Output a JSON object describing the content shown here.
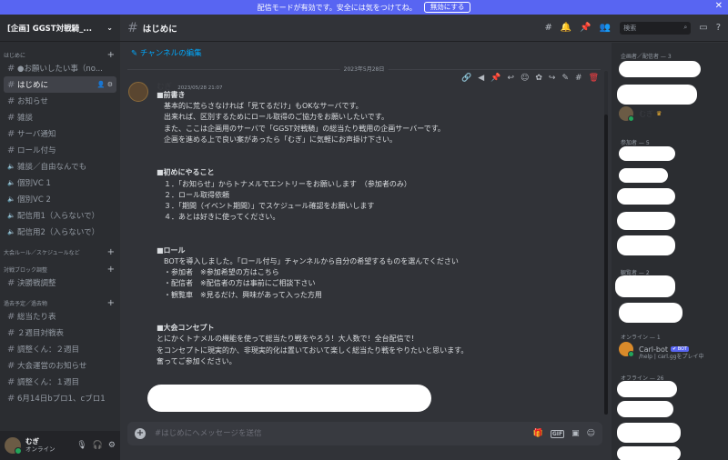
{
  "banner": {
    "text": "配信モードが有効です。安全には気をつけてね。",
    "button_label": "無効にする",
    "close_glyph": "✕"
  },
  "server": {
    "name": "[企画] GGST対戦騎_..."
  },
  "sidebar": {
    "categories": [
      {
        "label": "はじめに",
        "channels": [
          {
            "label": "●お願いしたい事（no...",
            "type": "text",
            "active": false
          },
          {
            "label": "はじめに",
            "type": "text",
            "active": true
          },
          {
            "label": "お知らせ",
            "type": "text",
            "active": false
          },
          {
            "label": "雑談",
            "type": "text",
            "active": false
          },
          {
            "label": "サーバ通知",
            "type": "text",
            "active": false
          },
          {
            "label": "ロール付与",
            "type": "text",
            "active": false
          },
          {
            "label": "雑談／自由なんでも",
            "type": "voice",
            "active": false
          },
          {
            "label": "個別VC 1",
            "type": "voice",
            "active": false
          },
          {
            "label": "個別VC 2",
            "type": "voice",
            "active": false
          },
          {
            "label": "配信用1（入らないで）",
            "type": "voice",
            "active": false
          },
          {
            "label": "配信用2（入らないで）",
            "type": "voice",
            "active": false
          }
        ]
      },
      {
        "label": "大会ルール／スケジュールなど",
        "channels": []
      },
      {
        "label": "対戦ブロック調整",
        "channels": [
          {
            "label": "決勝戦調整",
            "type": "text",
            "active": false
          }
        ]
      },
      {
        "label": "過去予定／過去物",
        "channels": [
          {
            "label": "総当たり表",
            "type": "text",
            "active": false
          },
          {
            "label": "２週目対戦表",
            "type": "text",
            "active": false
          },
          {
            "label": "調整くん：２週目",
            "type": "text",
            "active": false
          },
          {
            "label": "大会運営のお知らせ",
            "type": "text",
            "active": false
          },
          {
            "label": "調整くん：１週目",
            "type": "text",
            "active": false
          },
          {
            "label": "6月14日bブロ1、cブロ1",
            "type": "text",
            "active": false
          }
        ]
      }
    ]
  },
  "user": {
    "name": "むぎ",
    "status": "オンライン"
  },
  "channel": {
    "title": "はじめに",
    "edit_link": "✎ チャンネルの編集"
  },
  "search": {
    "placeholder": "検索"
  },
  "message": {
    "date": "2023年5月28日",
    "author": "むぎ",
    "timestamp": "2023/05/28 21:07",
    "lines": [
      "■前書き",
      "　基本的に荒らさなければ「見てるだけ」もOKなサーバです。",
      "　出来れば、区別するためにロール取得のご協力をお願いしたいです。",
      "　また、ここは企画用のサーバで「GGST対戦騎」の総当たり戦用の企画サーバーです。",
      "　企画を進める上で良い案があったら「むぎ」に気軽にお声掛け下さい。",
      "",
      "",
      "■初めにやること",
      "　１．「お知らせ」からトナメルでエントリーをお願いします　（参加者のみ）",
      "　２．ロール取得依頼",
      "　３．「期間（イベント期間）」でスケジュール確認をお願いします",
      "　４．あとは好きに使ってください。",
      "",
      "",
      "■ロール",
      "　BOTを導入しました。「ロール付与」チャンネルから自分の希望するものを選んでください",
      "　・参加者　※参加希望の方はこちら",
      "　・配信者　※配信者の方は事前にご相談下さい",
      "　・観覧車　※見るだけ、興味があって入った方用",
      "",
      "",
      "■大会コンセプト",
      "とにかくトナメルの機能を使って総当たり戦をやろう！大人数で！全台配信で！",
      "をコンセプトに現実的か、非現実的化は置いておいて楽しく総当たり戦をやりたいと思います。",
      "奮ってご参加ください。"
    ]
  },
  "composer": {
    "placeholder": "#はじめにへメッセージを送信"
  },
  "members": {
    "role1": "企画者／配信者 — 3",
    "role2": "参加者 — 5",
    "role3": "観覧者 — 2",
    "online": "オンライン — 1",
    "offline": "オフライン — 26",
    "visible_user": "むぎ",
    "carl_name": "Carl-bot",
    "carl_badge": "✔ BOT",
    "carl_status": "/help | carl.ggをプレイ中"
  },
  "colors": {
    "accent": "#5865f2",
    "online": "#23a55a",
    "link": "#00a8fc",
    "danger": "#f23f43"
  }
}
